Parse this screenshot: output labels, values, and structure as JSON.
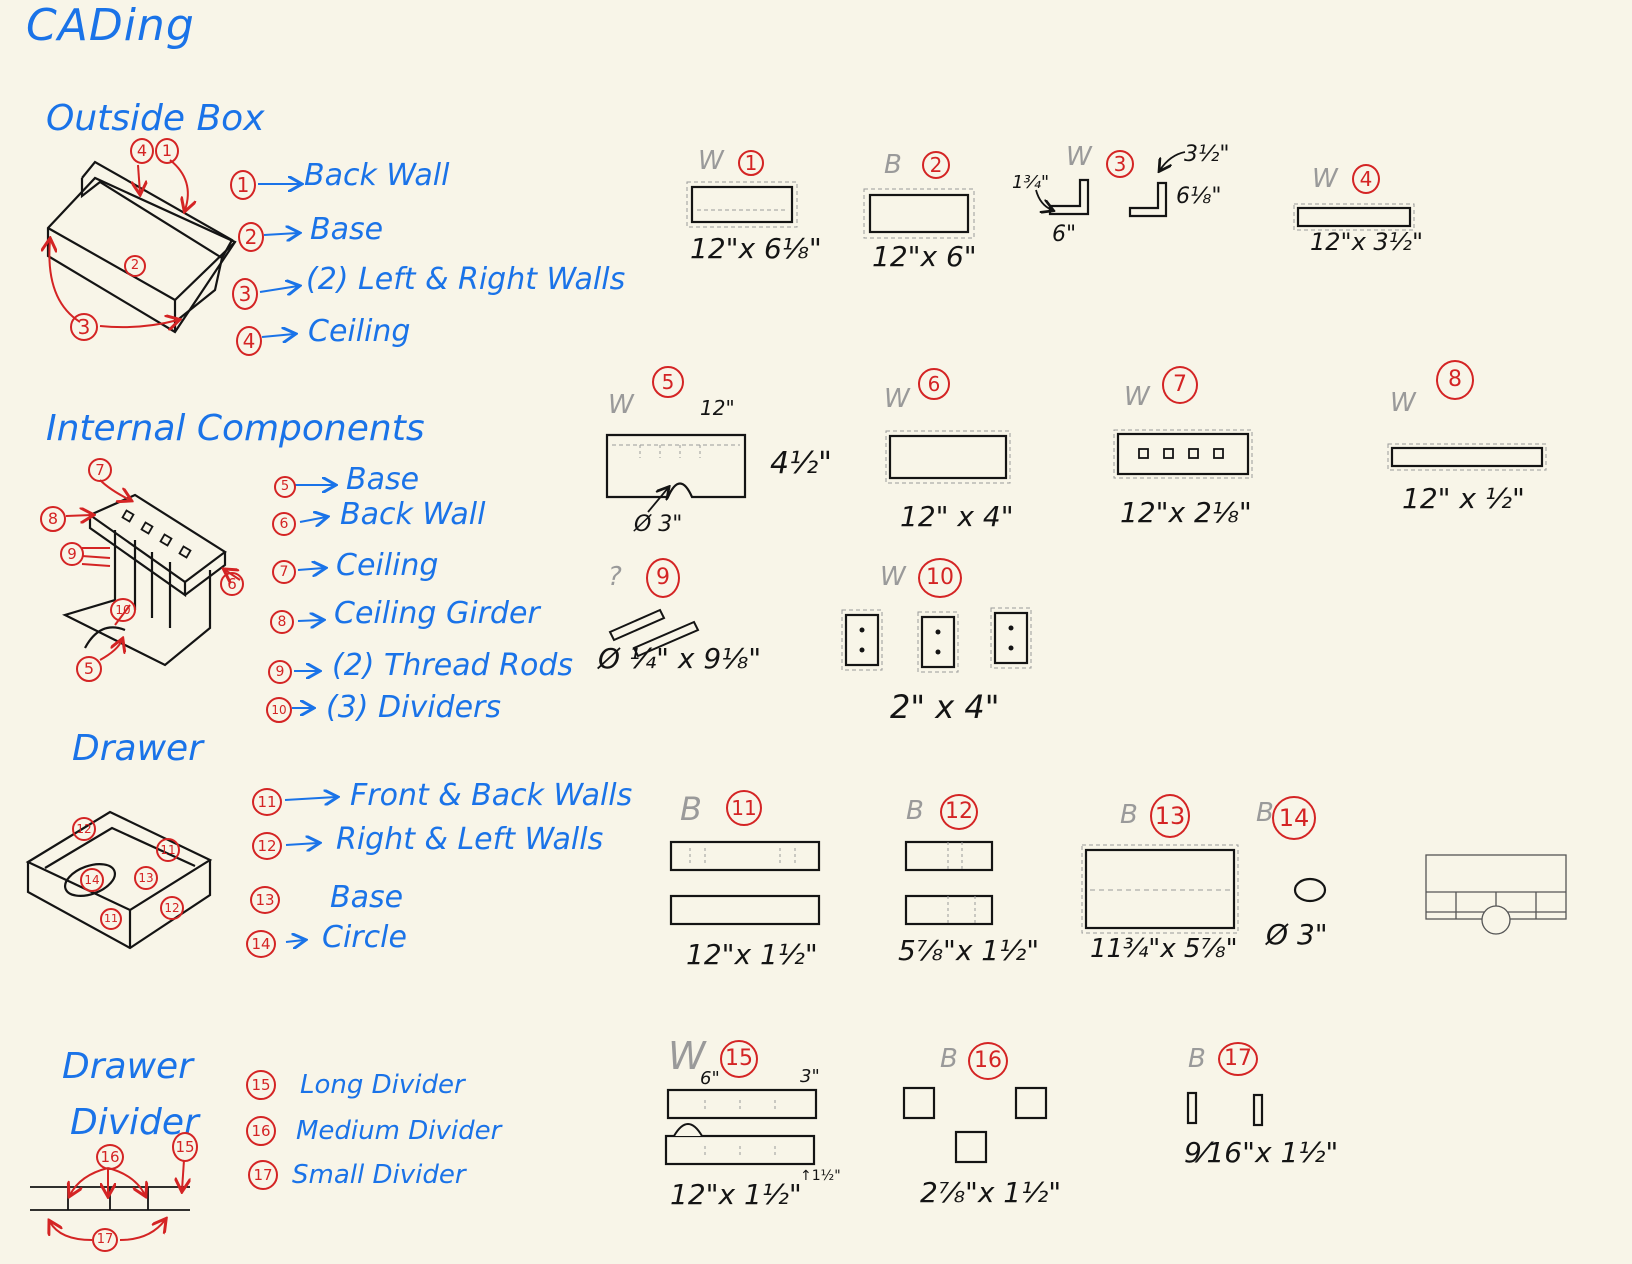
{
  "title": "CADing",
  "sections": {
    "outside_box": {
      "heading": "Outside Box",
      "items": [
        {
          "num": "1",
          "label": "Back Wall"
        },
        {
          "num": "2",
          "label": "Base"
        },
        {
          "num": "3",
          "label": "(2) Left & Right Walls"
        },
        {
          "num": "4",
          "label": "Ceiling"
        }
      ]
    },
    "internal_components": {
      "heading": "Internal Components",
      "items": [
        {
          "num": "5",
          "label": "Base"
        },
        {
          "num": "6",
          "label": "Back Wall"
        },
        {
          "num": "7",
          "label": "Ceiling"
        },
        {
          "num": "8",
          "label": "Ceiling Girder"
        },
        {
          "num": "9",
          "label": "(2) Thread Rods"
        },
        {
          "num": "10",
          "label": "(3) Dividers"
        }
      ]
    },
    "drawer": {
      "heading": "Drawer",
      "items": [
        {
          "num": "11",
          "label": "Front & Back Walls"
        },
        {
          "num": "12",
          "label": "Right & Left Walls"
        },
        {
          "num": "13",
          "label": "Base"
        },
        {
          "num": "14",
          "label": "Circle"
        }
      ]
    },
    "drawer_divider": {
      "heading_1": "Drawer",
      "heading_2": "Divider",
      "items": [
        {
          "num": "15",
          "label": "Long Divider"
        },
        {
          "num": "16",
          "label": "Medium Divider"
        },
        {
          "num": "17",
          "label": "Small Divider"
        }
      ]
    }
  },
  "parts": {
    "p1": {
      "num": "1",
      "material": "W",
      "dim": "12\"x 6⅛\""
    },
    "p2": {
      "num": "2",
      "material": "B",
      "dim": "12\"x 6\""
    },
    "p3": {
      "num": "3",
      "material": "W",
      "dim_side": "1¾\"",
      "dim_bottom": "6\"",
      "dim_top": "3½\"",
      "dim_right": "6⅛\""
    },
    "p4": {
      "num": "4",
      "material": "W",
      "dim": "12\"x 3½\""
    },
    "p5": {
      "num": "5",
      "material": "W",
      "dim_top": "12\"",
      "dim_right": "4½\"",
      "dim_hole": "Ø 3\""
    },
    "p6": {
      "num": "6",
      "material": "W",
      "dim": "12\" x 4\""
    },
    "p7": {
      "num": "7",
      "material": "W",
      "dim": "12\"x 2⅛\""
    },
    "p8": {
      "num": "8",
      "material": "W",
      "dim": "12\" x ½\""
    },
    "p9": {
      "num": "9",
      "material": "?",
      "dim": "Ø ¼\" x 9⅛\""
    },
    "p10": {
      "num": "10",
      "material": "W",
      "dim": "2\" x 4\""
    },
    "p11": {
      "num": "11",
      "material": "B",
      "dim": "12\"x 1½\""
    },
    "p12": {
      "num": "12",
      "material": "B",
      "dim": "5⅞\"x 1½\""
    },
    "p13": {
      "num": "13",
      "material": "B",
      "dim": "11¾\"x 5⅞\""
    },
    "p14": {
      "num": "14",
      "material": "B",
      "dim": "Ø 3\""
    },
    "p15": {
      "num": "15",
      "material": "W",
      "dim_a": "6\"",
      "dim_b": "3\"",
      "dim": "12\"x 1½\"",
      "dim_c": "↑1½\""
    },
    "p16": {
      "num": "16",
      "material": "B",
      "dim": "2⅞\"x 1½\""
    },
    "p17": {
      "num": "17",
      "material": "B",
      "dim": "9⁄16\"x 1½\""
    }
  },
  "colors": {
    "background": "#f8f5e8",
    "blue_text": "#1a73e8",
    "red_markers": "#d42424",
    "ink": "#141414",
    "pencil": "#9a9a9a"
  }
}
